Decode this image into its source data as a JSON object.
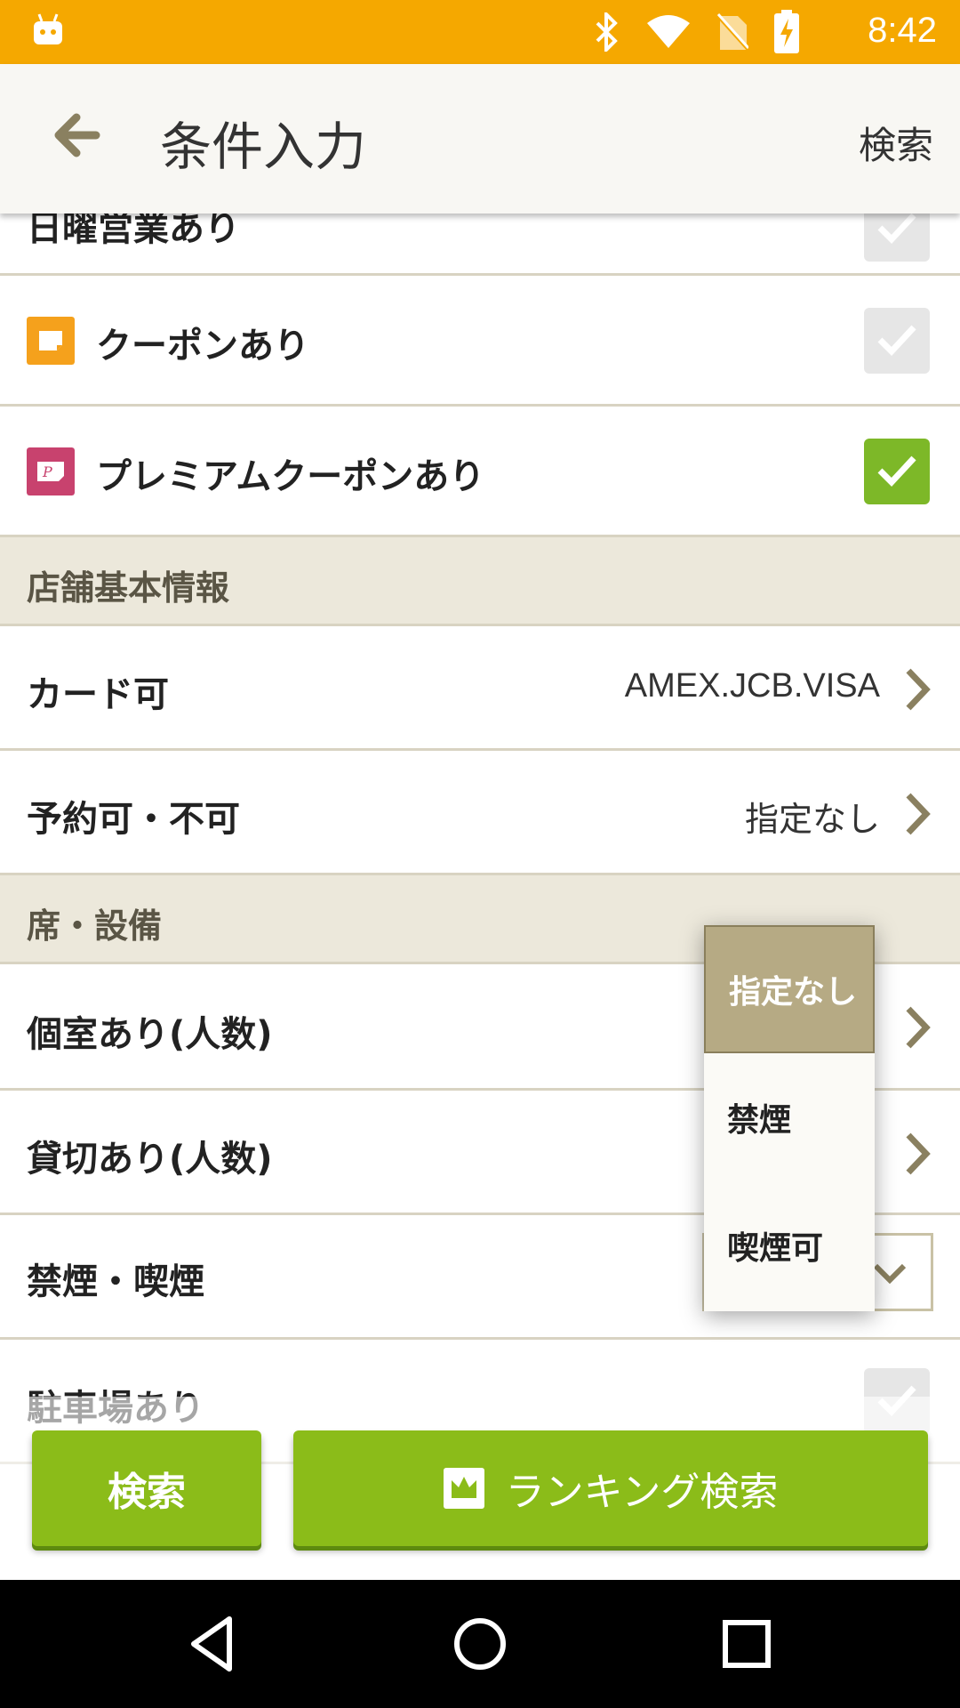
{
  "status_bar": {
    "time": "8:42",
    "icons": [
      "android-icon",
      "bluetooth-icon",
      "wifi-icon",
      "no-sim-icon",
      "battery-charging-icon"
    ],
    "color": "#f5a800"
  },
  "app_bar": {
    "title": "条件入力",
    "search_label": "検索"
  },
  "rows": {
    "sunday_label": "日曜営業あり",
    "coupon_label": "クーポンあり",
    "premium_coupon_label": "プレミアムクーポンあり",
    "card_label": "カード可",
    "card_value": "AMEX.JCB.VISA",
    "reserve_label": "予約可・不可",
    "reserve_value": "指定なし",
    "private_room_label": "個室あり(人数)",
    "charter_label": "貸切あり(人数)",
    "smoking_label": "禁煙・喫煙",
    "parking_label": "駐車場あり"
  },
  "checkboxes": {
    "sunday": true,
    "coupon": false,
    "premium_coupon": true,
    "parking": false
  },
  "sections": {
    "store_info": "店舗基本情報",
    "seats": "席・設備"
  },
  "popup": {
    "options": [
      "指定なし",
      "禁煙",
      "喫煙可"
    ],
    "selected": "指定なし"
  },
  "buttons": {
    "search": "検索",
    "ranking": "ランキング検索"
  },
  "colors": {
    "accent_green": "#8bbc19",
    "check_green": "#7db828",
    "section_bg": "#ece8db",
    "coupon_orange": "#f5a11c",
    "premium_pink": "#c8426e",
    "popup_selected": "#b6aa84"
  }
}
